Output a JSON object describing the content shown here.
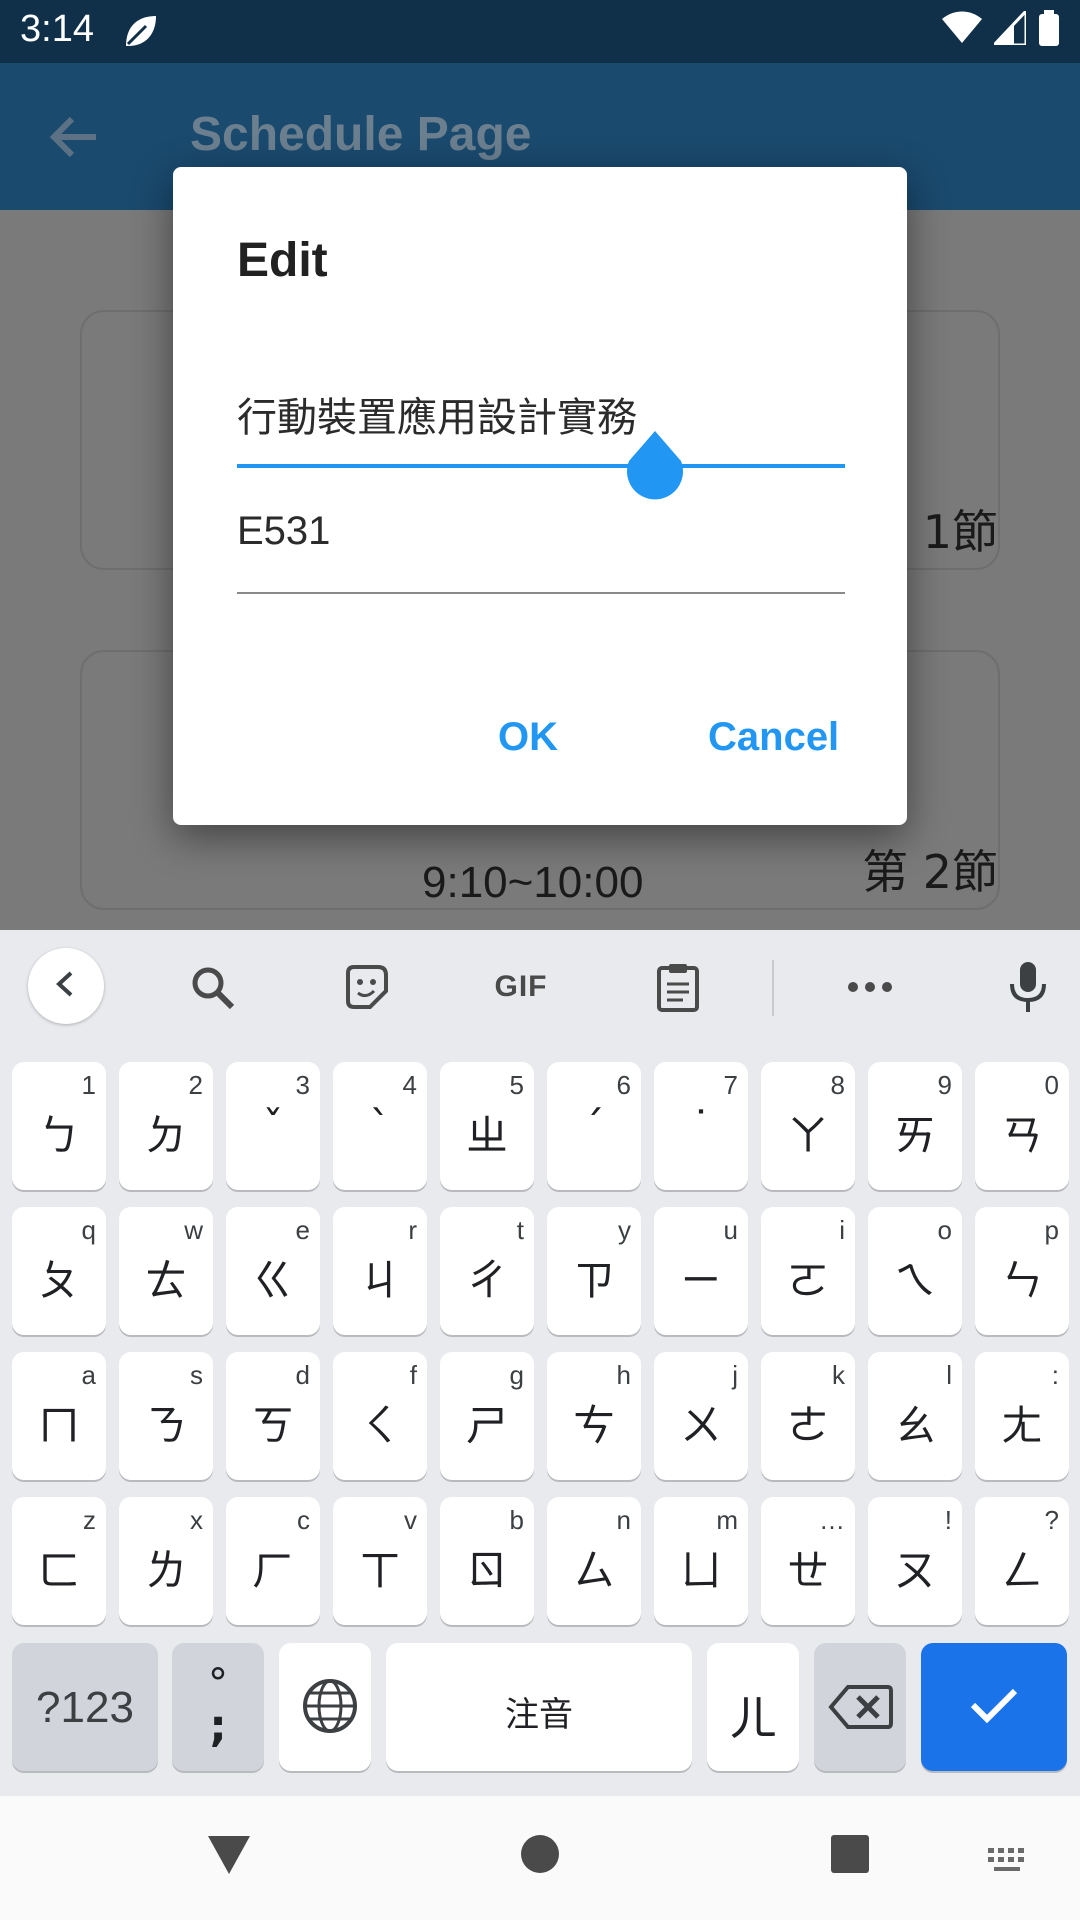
{
  "status_bar": {
    "time": "3:14"
  },
  "app_bar": {
    "title": "Schedule Page"
  },
  "schedule": {
    "cards": [
      {
        "time": "",
        "period": "1節"
      },
      {
        "time": "9:10~10:00",
        "period": "第  2節"
      }
    ]
  },
  "dialog": {
    "title": "Edit",
    "course_name": "行動裝置應用設計實務",
    "room": "E531",
    "ok_label": "OK",
    "cancel_label": "Cancel"
  },
  "keyboard": {
    "toolbar": {
      "gif_label": "GIF"
    },
    "rows": [
      [
        {
          "main": "ㄅ",
          "hint": "1"
        },
        {
          "main": "ㄉ",
          "hint": "2"
        },
        {
          "main": "ˇ",
          "hint": "3"
        },
        {
          "main": "ˋ",
          "hint": "4"
        },
        {
          "main": "ㄓ",
          "hint": "5"
        },
        {
          "main": "ˊ",
          "hint": "6"
        },
        {
          "main": "˙",
          "hint": "7"
        },
        {
          "main": "ㄚ",
          "hint": "8"
        },
        {
          "main": "ㄞ",
          "hint": "9"
        },
        {
          "main": "ㄢ",
          "hint": "0"
        }
      ],
      [
        {
          "main": "ㄆ",
          "hint": "q"
        },
        {
          "main": "ㄊ",
          "hint": "w"
        },
        {
          "main": "ㄍ",
          "hint": "e"
        },
        {
          "main": "ㄐ",
          "hint": "r"
        },
        {
          "main": "ㄔ",
          "hint": "t"
        },
        {
          "main": "ㄗ",
          "hint": "y"
        },
        {
          "main": "ㄧ",
          "hint": "u"
        },
        {
          "main": "ㄛ",
          "hint": "i"
        },
        {
          "main": "ㄟ",
          "hint": "o"
        },
        {
          "main": "ㄣ",
          "hint": "p"
        }
      ],
      [
        {
          "main": "ㄇ",
          "hint": "a"
        },
        {
          "main": "ㄋ",
          "hint": "s"
        },
        {
          "main": "ㄎ",
          "hint": "d"
        },
        {
          "main": "ㄑ",
          "hint": "f"
        },
        {
          "main": "ㄕ",
          "hint": "g"
        },
        {
          "main": "ㄘ",
          "hint": "h"
        },
        {
          "main": "ㄨ",
          "hint": "j"
        },
        {
          "main": "ㄜ",
          "hint": "k"
        },
        {
          "main": "ㄠ",
          "hint": "l"
        },
        {
          "main": "ㄤ",
          "hint": ":"
        }
      ],
      [
        {
          "main": "ㄈ",
          "hint": "z"
        },
        {
          "main": "ㄌ",
          "hint": "x"
        },
        {
          "main": "ㄏ",
          "hint": "c"
        },
        {
          "main": "ㄒ",
          "hint": "v"
        },
        {
          "main": "ㄖ",
          "hint": "b"
        },
        {
          "main": "ㄙ",
          "hint": "n"
        },
        {
          "main": "ㄩ",
          "hint": "m"
        },
        {
          "main": "ㄝ",
          "hint": "…"
        },
        {
          "main": "ㄡ",
          "hint": "!"
        },
        {
          "main": "ㄥ",
          "hint": "?"
        }
      ]
    ],
    "bottom": {
      "symbols_label": "?123",
      "punct_top": "°",
      "punct_bottom": ";",
      "space_label": "注音",
      "er_key": "ㄦ"
    }
  },
  "colors": {
    "accent": "#2196f3",
    "enter_key": "#1a73e8"
  }
}
